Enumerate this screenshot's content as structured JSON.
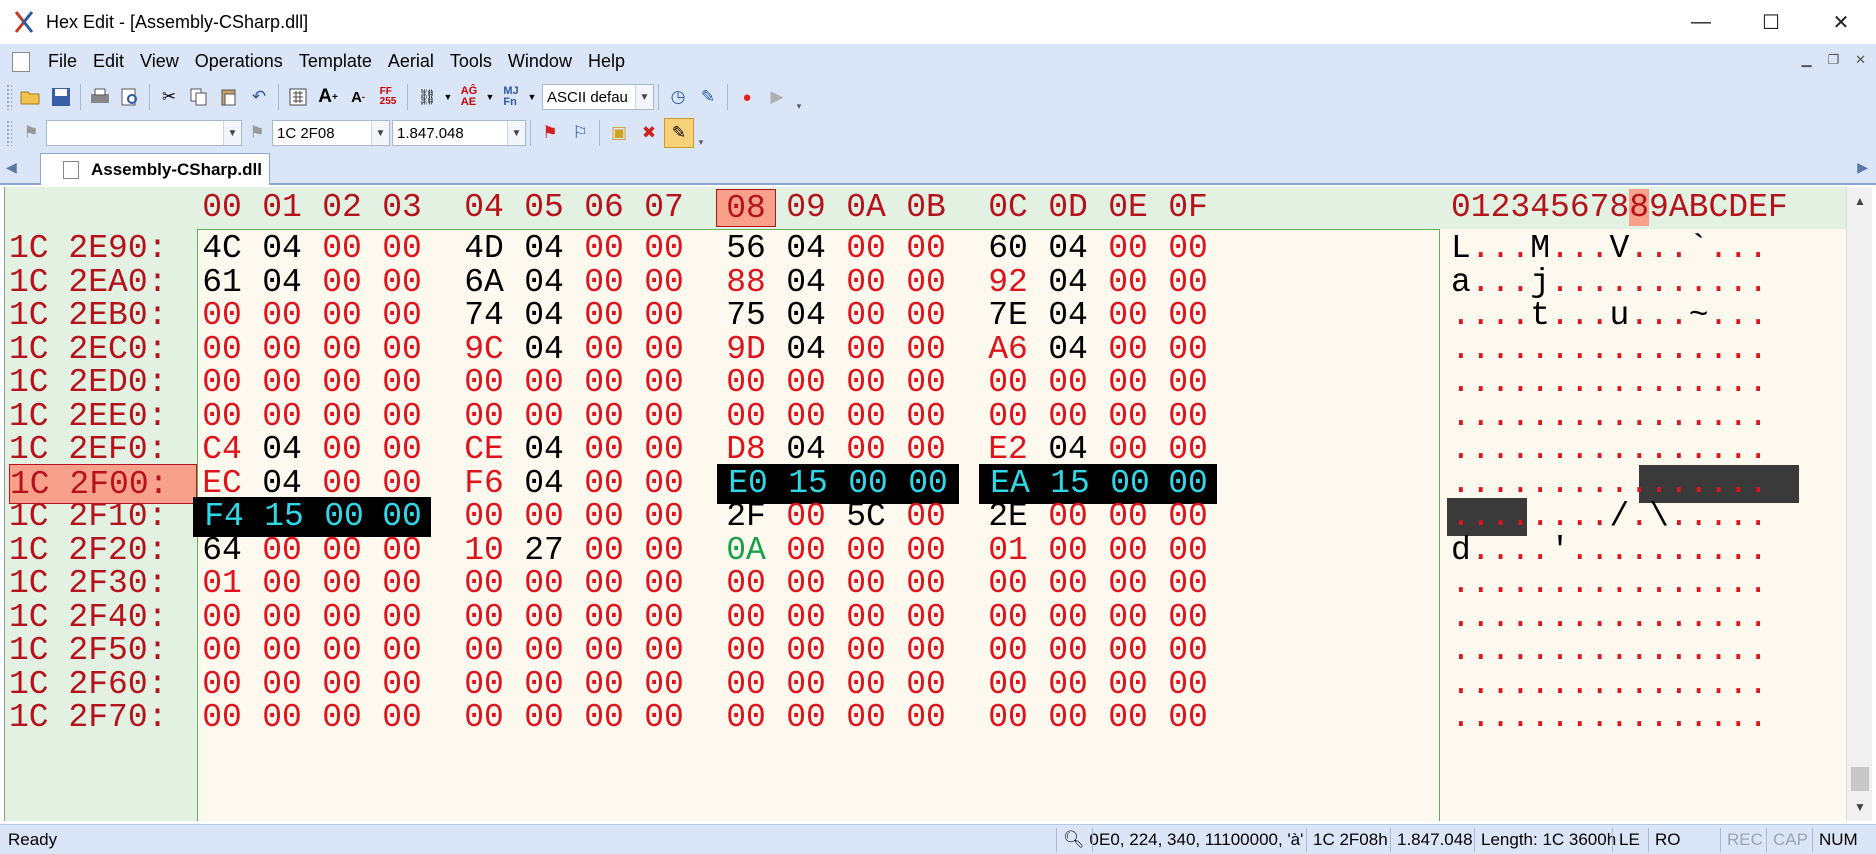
{
  "window": {
    "title": "Hex Edit - [Assembly-CSharp.dll]",
    "minimize": "—",
    "maximize": "☐",
    "close": "✕"
  },
  "menu": [
    "File",
    "Edit",
    "View",
    "Operations",
    "Template",
    "Aerial",
    "Tools",
    "Window",
    "Help"
  ],
  "toolbar": {
    "charset_combo": "ASCII defau",
    "bookmark_combo": "",
    "address_combo": "1C 2F08",
    "decimal_combo": "1.847.048"
  },
  "tab": {
    "label": "Assembly-CSharp.dll"
  },
  "hex": {
    "col_headers": [
      "00",
      "01",
      "02",
      "03",
      "04",
      "05",
      "06",
      "07",
      "08",
      "09",
      "0A",
      "0B",
      "0C",
      "0D",
      "0E",
      "0F"
    ],
    "ascii_header_before": "012345678",
    "ascii_header_cur": "8",
    "ascii_header_after": "9ABCDEF",
    "current_column": "08",
    "rows": [
      {
        "addr": "1C 2E90:",
        "bytes": [
          "4C",
          "04",
          "00",
          "00",
          "4D",
          "04",
          "00",
          "00",
          "56",
          "04",
          "00",
          "00",
          "60",
          "04",
          "00",
          "00"
        ],
        "ascii": "L...M...V...`..."
      },
      {
        "addr": "1C 2EA0:",
        "bytes": [
          "61",
          "04",
          "00",
          "00",
          "6A",
          "04",
          "00",
          "00",
          "88",
          "04",
          "00",
          "00",
          "92",
          "04",
          "00",
          "00"
        ],
        "ascii": "a...j..........."
      },
      {
        "addr": "1C 2EB0:",
        "bytes": [
          "00",
          "00",
          "00",
          "00",
          "74",
          "04",
          "00",
          "00",
          "75",
          "04",
          "00",
          "00",
          "7E",
          "04",
          "00",
          "00"
        ],
        "ascii": "....t...u...~..."
      },
      {
        "addr": "1C 2EC0:",
        "bytes": [
          "00",
          "00",
          "00",
          "00",
          "9C",
          "04",
          "00",
          "00",
          "9D",
          "04",
          "00",
          "00",
          "A6",
          "04",
          "00",
          "00"
        ],
        "ascii": "................"
      },
      {
        "addr": "1C 2ED0:",
        "bytes": [
          "00",
          "00",
          "00",
          "00",
          "00",
          "00",
          "00",
          "00",
          "00",
          "00",
          "00",
          "00",
          "00",
          "00",
          "00",
          "00"
        ],
        "ascii": "................"
      },
      {
        "addr": "1C 2EE0:",
        "bytes": [
          "00",
          "00",
          "00",
          "00",
          "00",
          "00",
          "00",
          "00",
          "00",
          "00",
          "00",
          "00",
          "00",
          "00",
          "00",
          "00"
        ],
        "ascii": "................"
      },
      {
        "addr": "1C 2EF0:",
        "bytes": [
          "C4",
          "04",
          "00",
          "00",
          "CE",
          "04",
          "00",
          "00",
          "D8",
          "04",
          "00",
          "00",
          "E2",
          "04",
          "00",
          "00"
        ],
        "ascii": "................"
      },
      {
        "addr": "1C 2F00:",
        "bytes": [
          "EC",
          "04",
          "00",
          "00",
          "F6",
          "04",
          "00",
          "00",
          "E0",
          "15",
          "00",
          "00",
          "EA",
          "15",
          "00",
          "00"
        ],
        "ascii": "................"
      },
      {
        "addr": "1C 2F10:",
        "bytes": [
          "F4",
          "15",
          "00",
          "00",
          "00",
          "00",
          "00",
          "00",
          "2F",
          "00",
          "5C",
          "00",
          "2E",
          "00",
          "00",
          "00"
        ],
        "ascii": "......../.\\....."
      },
      {
        "addr": "1C 2F20:",
        "bytes": [
          "64",
          "00",
          "00",
          "00",
          "10",
          "27",
          "00",
          "00",
          "0A",
          "00",
          "00",
          "00",
          "01",
          "00",
          "00",
          "00"
        ],
        "ascii": "d....'.........."
      },
      {
        "addr": "1C 2F30:",
        "bytes": [
          "01",
          "00",
          "00",
          "00",
          "00",
          "00",
          "00",
          "00",
          "00",
          "00",
          "00",
          "00",
          "00",
          "00",
          "00",
          "00"
        ],
        "ascii": "................"
      },
      {
        "addr": "1C 2F40:",
        "bytes": [
          "00",
          "00",
          "00",
          "00",
          "00",
          "00",
          "00",
          "00",
          "00",
          "00",
          "00",
          "00",
          "00",
          "00",
          "00",
          "00"
        ],
        "ascii": "................"
      },
      {
        "addr": "1C 2F50:",
        "bytes": [
          "00",
          "00",
          "00",
          "00",
          "00",
          "00",
          "00",
          "00",
          "00",
          "00",
          "00",
          "00",
          "00",
          "00",
          "00",
          "00"
        ],
        "ascii": "................"
      },
      {
        "addr": "1C 2F60:",
        "bytes": [
          "00",
          "00",
          "00",
          "00",
          "00",
          "00",
          "00",
          "00",
          "00",
          "00",
          "00",
          "00",
          "00",
          "00",
          "00",
          "00"
        ],
        "ascii": "................"
      },
      {
        "addr": "1C 2F70:",
        "bytes": [
          "00",
          "00",
          "00",
          "00",
          "00",
          "00",
          "00",
          "00",
          "00",
          "00",
          "00",
          "00",
          "00",
          "00",
          "00",
          "00"
        ],
        "ascii": "................"
      }
    ],
    "current_row": "1C 2F00:"
  },
  "status": {
    "ready": "Ready",
    "count": "0",
    "value": "E0, 224, 340, 11100000, 'à'",
    "hex_addr": "1C 2F08h",
    "dec_addr": "1.847.048",
    "length": "Length: 1C 3600h",
    "endian": "LE",
    "mode": "RO",
    "rec": "REC",
    "cap": "CAP",
    "num": "NUM"
  }
}
